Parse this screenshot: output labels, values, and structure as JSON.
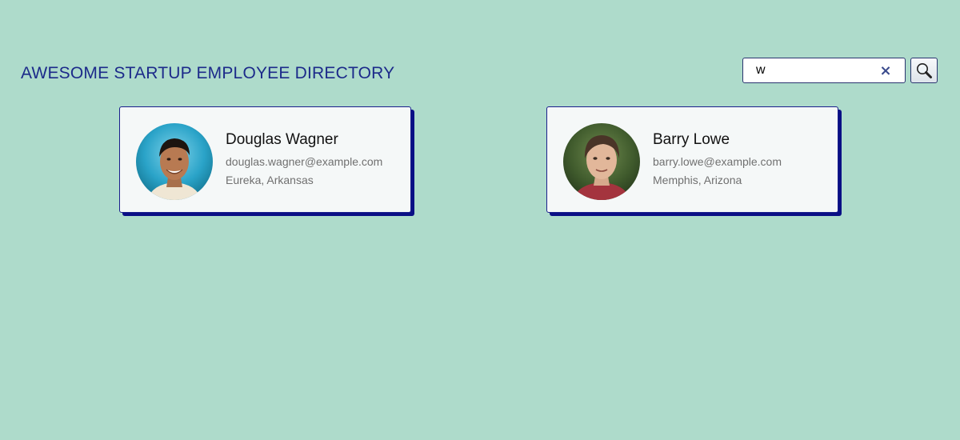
{
  "header": {
    "title": "AWESOME STARTUP EMPLOYEE DIRECTORY"
  },
  "search": {
    "value": "w",
    "clear_icon": "×",
    "search_icon": "magnifying-glass-icon"
  },
  "employees": [
    {
      "name": "Douglas Wagner",
      "email": "douglas.wagner@example.com",
      "location": "Eureka, Arkansas"
    },
    {
      "name": "Barry Lowe",
      "email": "barry.lowe@example.com",
      "location": "Memphis, Arizona"
    }
  ],
  "colors": {
    "background": "#aedbcb",
    "title": "#1c2a8a",
    "card_border": "#1a1f8c",
    "card_shadow": "#0a0f85"
  }
}
